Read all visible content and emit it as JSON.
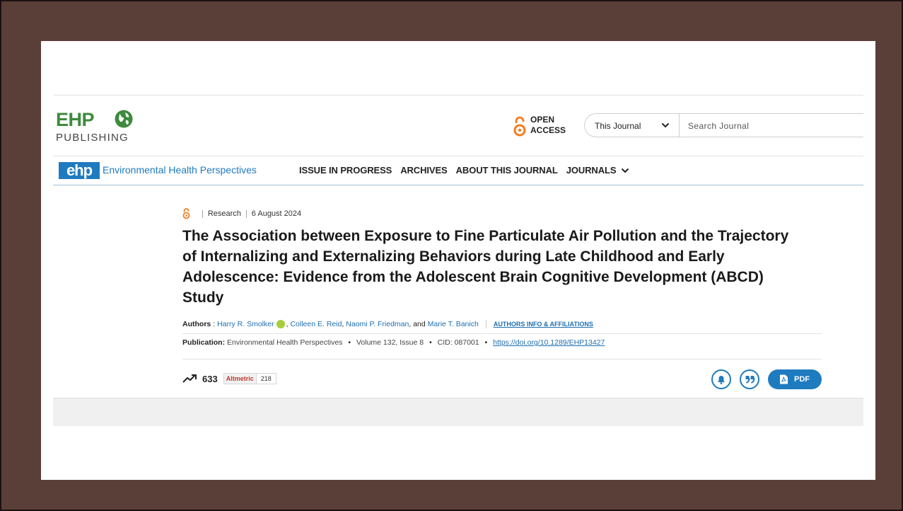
{
  "brand": {
    "logo_top": "EHP",
    "logo_bottom": "PUBLISHING",
    "badge": "ehp",
    "journal_name": "Environmental Health Perspectives",
    "accent_color": "#1f7bbf",
    "logo_green": "#3d8b3d",
    "oa_orange": "#f47c20"
  },
  "header": {
    "open_access_line1": "OPEN",
    "open_access_line2": "ACCESS",
    "scope_selected": "This Journal",
    "search_placeholder": "Search Journal"
  },
  "nav": {
    "items": [
      "ISSUE IN PROGRESS",
      "ARCHIVES",
      "ABOUT THIS JOURNAL",
      "JOURNALS"
    ]
  },
  "article": {
    "type": "Research",
    "date": "6 August 2024",
    "title": "The Association between Exposure to Fine Particulate Air Pollution and the Trajectory of Internalizing and Externalizing Behaviors during Late Childhood and Early Adolescence: Evidence from the Adolescent Brain Cognitive Development (ABCD) Study",
    "authors_label": "Authors",
    "authors": [
      "Harry R. Smolker",
      "Colleen E. Reid",
      "Naomi P. Friedman",
      "Marie T. Banich"
    ],
    "authors_and": ", and ",
    "affiliations_link": "AUTHORS INFO & AFFILIATIONS",
    "publication_label": "Publication",
    "journal": "Environmental Health Perspectives",
    "volume_issue": "Volume 132, Issue 8",
    "cid": "CID: 087001",
    "doi": "https://doi.org/10.1289/EHP13427"
  },
  "metrics": {
    "views": "633",
    "altmetric_brand": "Altmetric",
    "altmetric_score": "218",
    "pdf_label": "PDF"
  }
}
